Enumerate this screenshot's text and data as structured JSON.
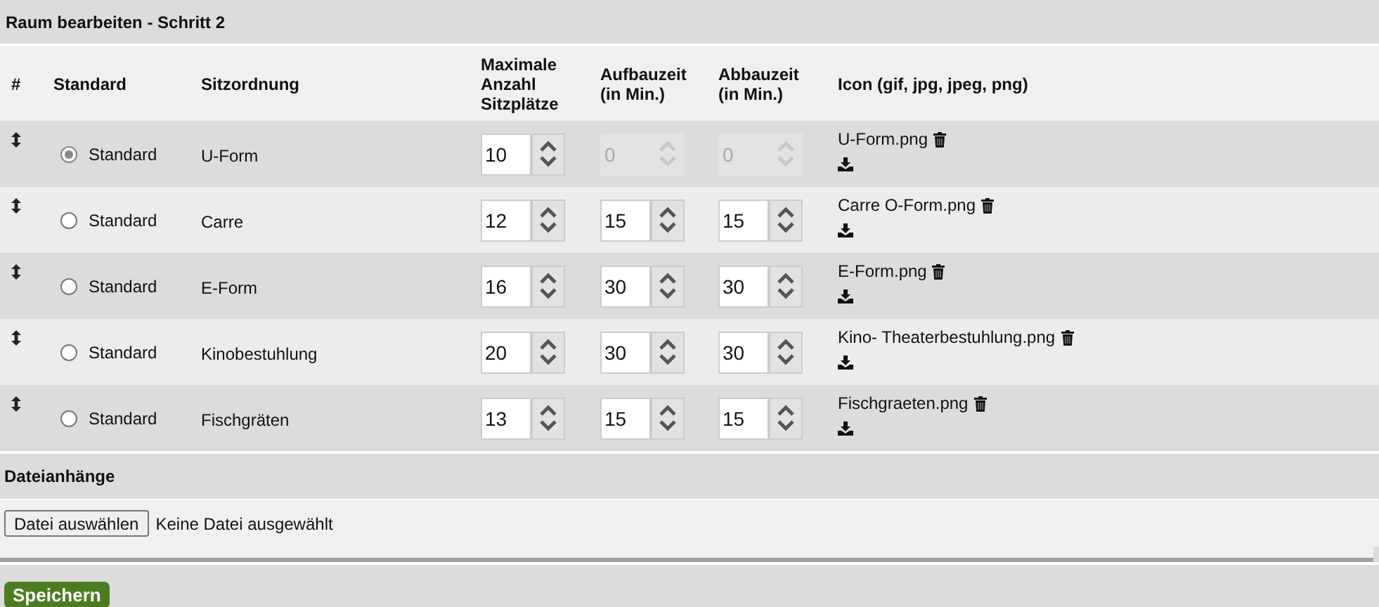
{
  "title": "Raum bearbeiten - Schritt 2",
  "columns": [
    "#",
    "Standard",
    "Sitzordnung",
    "Maximale Anzahl Sitzplätze",
    "Aufbauzeit (in Min.)",
    "Abbauzeit (in Min.)",
    "Icon (gif, jpg, jpeg, png)"
  ],
  "rows": [
    {
      "default_label": "Standard",
      "selected": true,
      "arrangement": "U-Form",
      "max_seats": "10",
      "setup_time": "0",
      "teardown_time": "0",
      "times_disabled": true,
      "icon_file": "U-Form.png"
    },
    {
      "default_label": "Standard",
      "selected": false,
      "arrangement": "Carre",
      "max_seats": "12",
      "setup_time": "15",
      "teardown_time": "15",
      "times_disabled": false,
      "icon_file": "Carre O-Form.png"
    },
    {
      "default_label": "Standard",
      "selected": false,
      "arrangement": "E-Form",
      "max_seats": "16",
      "setup_time": "30",
      "teardown_time": "30",
      "times_disabled": false,
      "icon_file": "E-Form.png"
    },
    {
      "default_label": "Standard",
      "selected": false,
      "arrangement": "Kinobestuhlung",
      "max_seats": "20",
      "setup_time": "30",
      "teardown_time": "30",
      "times_disabled": false,
      "icon_file": "Kino- Theaterbestuhlung.png"
    },
    {
      "default_label": "Standard",
      "selected": false,
      "arrangement": "Fischgräten",
      "max_seats": "13",
      "setup_time": "15",
      "teardown_time": "15",
      "times_disabled": false,
      "icon_file": "Fischgraeten.png"
    }
  ],
  "attachments": {
    "title": "Dateianhänge",
    "button": "Datei auswählen",
    "status": "Keine Datei ausgewählt"
  },
  "save_button": "Speichern"
}
